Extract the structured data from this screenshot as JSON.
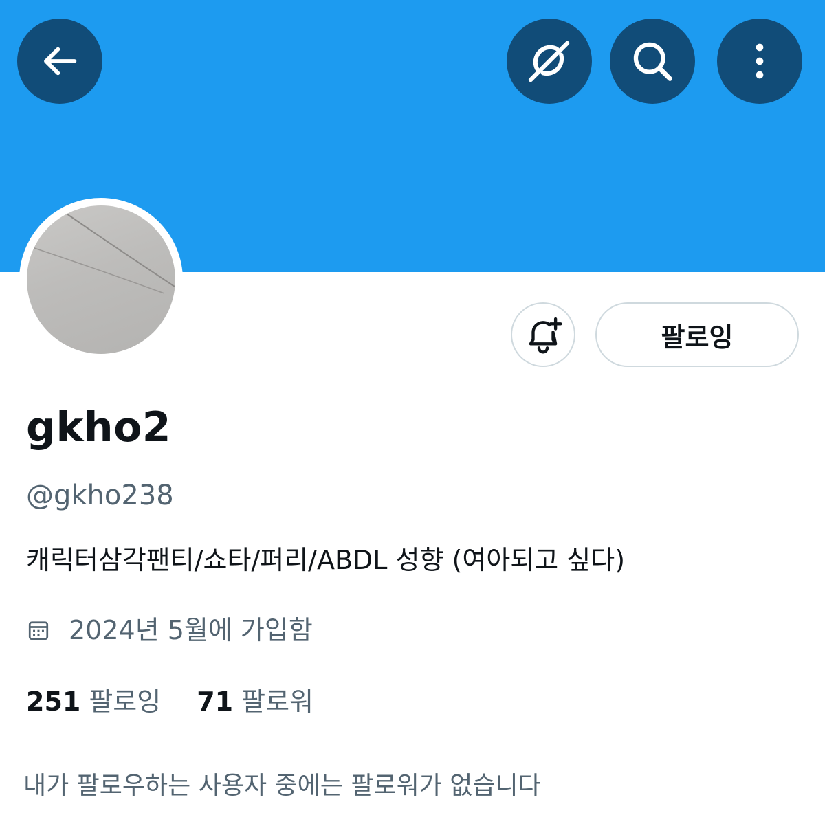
{
  "profile": {
    "display_name": "gkho2",
    "handle": "@gkho238",
    "bio": "캐릭터삼각팬티/쇼타/퍼리/ABDL 성향 (여아되고 싶다)",
    "joined": "2024년 5월에 가입함"
  },
  "actions": {
    "follow_label": "팔로잉"
  },
  "stats": {
    "following_count": "251",
    "following_label": "팔로잉",
    "followers_count": "71",
    "followers_label": "팔로워"
  },
  "followers_note": "내가 팔로우하는 사용자 중에는 팔로워가 없습니다",
  "icons": {
    "back": "arrow-left-icon",
    "grok": "grok-icon",
    "search": "search-icon",
    "more": "more-vertical-icon",
    "notify": "bell-plus-icon",
    "calendar": "calendar-icon"
  },
  "colors": {
    "banner": "#1d9bf0",
    "header_button": "#114c78",
    "text_primary": "#0f1419",
    "text_secondary": "#536471",
    "border": "#cfd9de"
  }
}
